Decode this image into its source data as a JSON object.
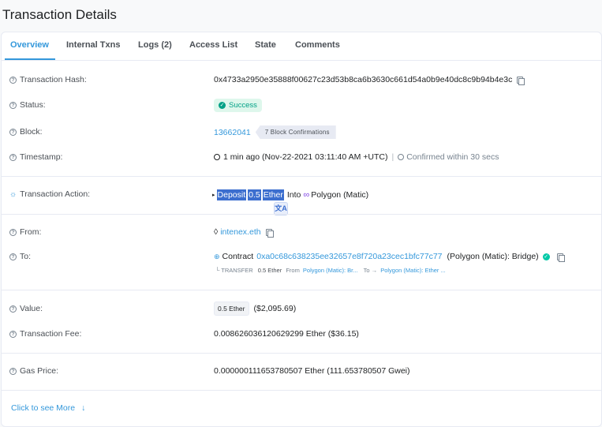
{
  "page": {
    "title": "Transaction Details"
  },
  "tabs": [
    {
      "label": "Overview"
    },
    {
      "label": "Internal Txns"
    },
    {
      "label": "Logs (2)"
    },
    {
      "label": "Access List"
    },
    {
      "label": "State"
    },
    {
      "label": "Comments"
    }
  ],
  "tx_hash": {
    "label": "Transaction Hash:",
    "value": "0x4733a2950e35888f00627c23d53b8ca6b3630c661d54a0b9e40dc8c9b94b4e3c"
  },
  "status": {
    "label": "Status:",
    "value": "Success",
    "color": "#00a186"
  },
  "block": {
    "label": "Block:",
    "number": "13662041",
    "confirmations": "7 Block Confirmations"
  },
  "timestamp": {
    "label": "Timestamp:",
    "value": "1 min ago (Nov-22-2021 03:11:40 AM +UTC)",
    "separator": "|",
    "confirmed": "Confirmed within 30 secs"
  },
  "tx_action": {
    "label": "Transaction Action:",
    "arrow": "▸",
    "word1": "Deposit",
    "word2": "0.5",
    "word3": "Ether",
    "into": "Into",
    "target": "Polygon (Matic)",
    "translate_icon": "文A"
  },
  "from": {
    "label": "From:",
    "value": "intenex.eth"
  },
  "to": {
    "label": "To:",
    "prefix": "Contract",
    "address": "0xa0c68c638235ee32657e8f720a23cec1bfc77c77",
    "name": "(Polygon (Matic): Bridge)",
    "transfer": {
      "tree": "└ TRANSFER",
      "amount": "0.5 Ether",
      "from_label": "From",
      "from": "Polygon (Matic): Br...",
      "to_label": "To →",
      "to": "Polygon (Matic): Ether ..."
    }
  },
  "value": {
    "label": "Value:",
    "amount": "0.5 Ether",
    "usd": "($2,095.69)"
  },
  "fee": {
    "label": "Transaction Fee:",
    "value": "0.008626036120629299 Ether ($36.15)"
  },
  "gas": {
    "label": "Gas Price:",
    "value": "0.000000111653780507 Ether (111.653780507 Gwei)"
  },
  "see_more": {
    "label": "Click to see More",
    "arrow": "↓"
  },
  "icons": {
    "help": "?",
    "check": "✓"
  },
  "colors": {
    "accent": "#3498db",
    "success": "#00a186",
    "highlight": "#3b6ecf"
  }
}
